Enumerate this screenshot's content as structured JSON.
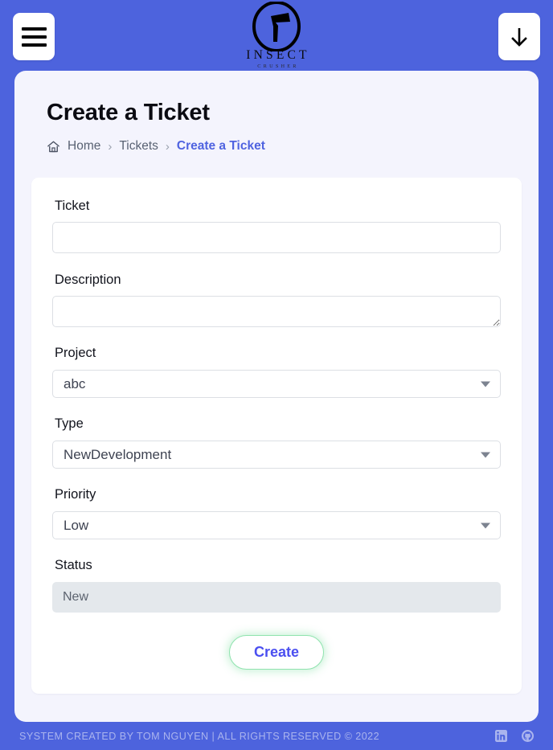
{
  "header": {
    "menu_button": "menu-hamburger",
    "download_button": "download-arrow",
    "logo_name": "INSECT",
    "logo_sub": "CRUSHER",
    "brand_blue": "#4d63dd"
  },
  "page": {
    "title": "Create a Ticket",
    "breadcrumb": {
      "home": "Home",
      "sep": "›",
      "parent": "Tickets",
      "current": "Create a Ticket",
      "current_color": "#4f63e0"
    }
  },
  "form": {
    "fields": {
      "ticket": {
        "label": "Ticket",
        "value": "",
        "placeholder": ""
      },
      "description": {
        "label": "Description",
        "value": "",
        "placeholder": ""
      },
      "project": {
        "label": "Project",
        "value": "abc"
      },
      "type": {
        "label": "Type",
        "value": "NewDevelopment"
      },
      "priority": {
        "label": "Priority",
        "value": "Low"
      },
      "status": {
        "label": "Status",
        "value": "New"
      }
    },
    "submit_label": "Create",
    "submit_border_color": "#8fe3ae",
    "submit_text_color": "#4b4ff0"
  },
  "footer": {
    "text": "SYSTEM CREATED BY TOM NGUYEN | ALL RIGHTS RESERVED © 2022",
    "linkedin": "linkedin-icon",
    "github": "github-icon"
  }
}
